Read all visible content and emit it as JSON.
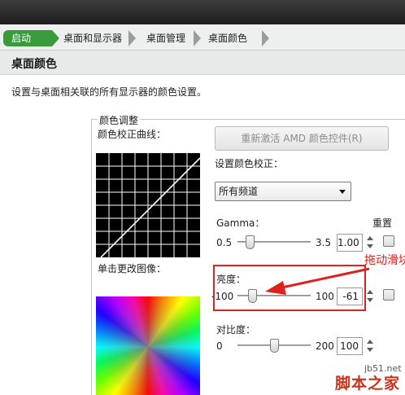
{
  "breadcrumb": {
    "items": [
      "启动",
      "桌面和显示器",
      "桌面管理",
      "桌面颜色"
    ]
  },
  "page": {
    "title": "桌面颜色",
    "description": "设置与桌面相关联的所有显示器的颜色设置。"
  },
  "color_adjust": {
    "group_label": "颜色调整",
    "curve_label": "颜色校正曲线：",
    "image_label": "单击更改图像：",
    "reactivate_button": "重新激活 AMD 颜色控件(R)",
    "set_correction_label": "设置颜色校正：",
    "channel_select": "所有频道",
    "reset_label": "重置"
  },
  "sliders": {
    "gamma": {
      "label": "Gamma：",
      "min": "0.5",
      "max": "3.5",
      "value": "1.00",
      "level": 0.17
    },
    "brightness": {
      "label": "亮度：",
      "min": "-100",
      "max": "100",
      "value": "-61",
      "level": 0.195
    },
    "contrast": {
      "label": "对比度：",
      "min": "0",
      "max": "200",
      "value": "100",
      "level": 0.5
    }
  },
  "annotation": {
    "text": "拖动滑块",
    "color": "#e0201c"
  },
  "watermark": {
    "site": "jb51.net",
    "name": "脚本之家"
  },
  "colors": {
    "accent_green": "#3a9b3c",
    "highlight_red": "#e0201c"
  }
}
